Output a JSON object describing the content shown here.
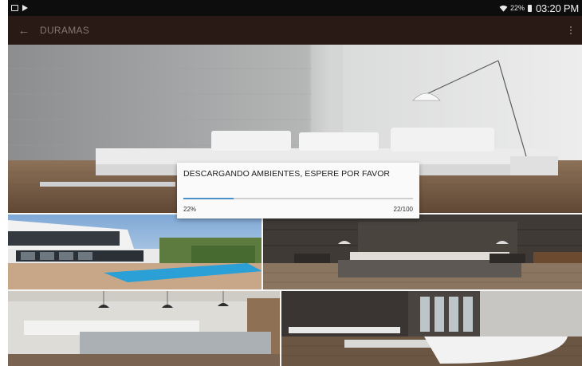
{
  "statusbar": {
    "battery_percent": "22%",
    "time": "03:20 PM",
    "icons": [
      "gallery-icon",
      "play-store-icon",
      "wifi-icon",
      "battery-icon"
    ]
  },
  "actionbar": {
    "back_icon": "arrow-left-icon",
    "title": "DURAMAS",
    "overflow_icon": "more-vertical-icon"
  },
  "gallery": {
    "tiles": [
      "living-room",
      "house-with-pool",
      "bedroom",
      "kitchen",
      "bathroom"
    ]
  },
  "dialog": {
    "message": "DESCARGANDO AMBIENTES, ESPERE POR FAVOR",
    "progress_fraction": 0.22,
    "percent_label": "22%",
    "count_label": "22/100"
  },
  "colors": {
    "actionbar": "#2a1a16",
    "statusbar": "#0d0d0d",
    "progress": "#4a90c8"
  }
}
